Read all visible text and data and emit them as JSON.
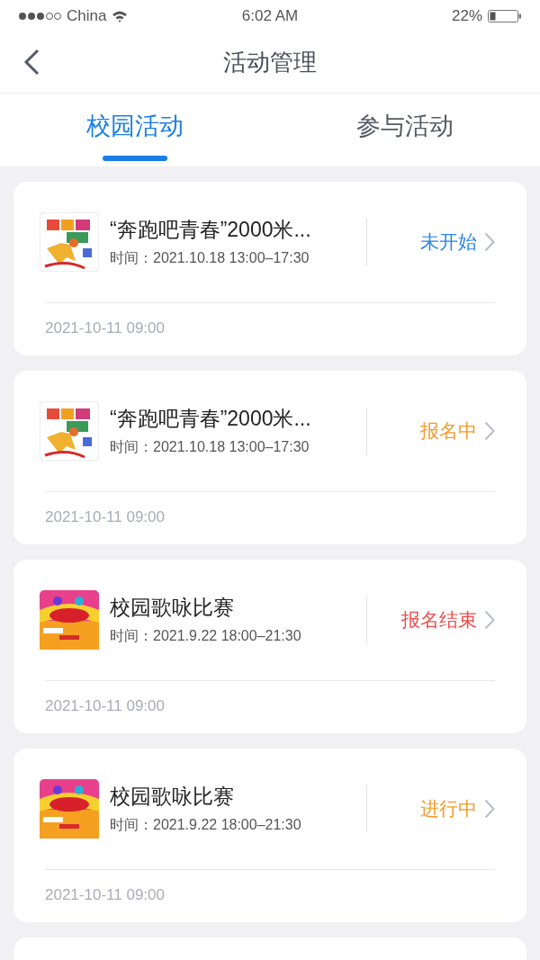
{
  "status_bar": {
    "carrier": "China",
    "time": "6:02 AM",
    "battery": "22%"
  },
  "nav": {
    "title": "活动管理"
  },
  "tabs": [
    {
      "label": "校园活动",
      "selected": true
    },
    {
      "label": "参与活动",
      "selected": false
    }
  ],
  "activities": [
    {
      "title": "“奔跑吧青春”2000米...",
      "time": "时间：2021.10.18 13:00–17:30",
      "status": "未开始",
      "kind": "not_started",
      "posted": "2021-10-11 09:00"
    },
    {
      "title": "“奔跑吧青春”2000米...",
      "time": "时间：2021.10.18 13:00–17:30",
      "status": "报名中",
      "kind": "signing_up",
      "posted": "2021-10-11 09:00"
    },
    {
      "title": "校园歌咏比赛",
      "time": "时间：2021.9.22 18:00–21:30",
      "status": "报名结束",
      "kind": "closed",
      "posted": "2021-10-11 09:00"
    },
    {
      "title": "校园歌咏比赛",
      "time": "时间：2021.9.22 18:00–21:30",
      "status": "进行中",
      "kind": "ongoing",
      "posted": "2021-10-11 09:00"
    }
  ]
}
